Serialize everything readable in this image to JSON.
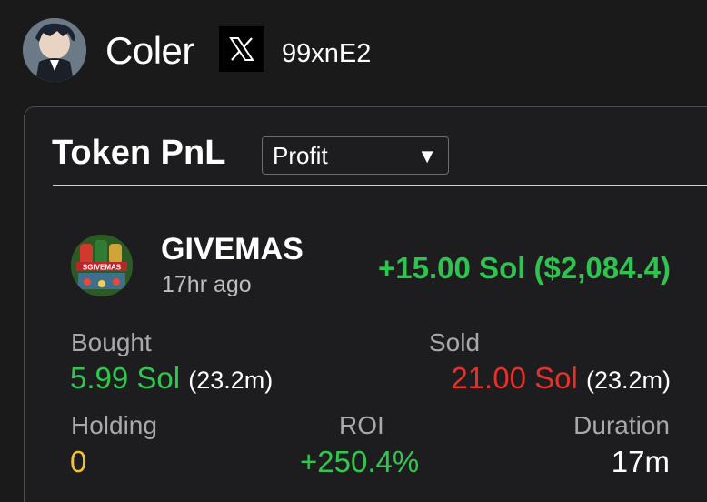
{
  "profile": {
    "name": "Coler",
    "x_icon": "x-logo-icon",
    "handle": "99xnE2"
  },
  "card": {
    "title": "Token PnL",
    "filter_selected": "Profit",
    "filter_caret": "▼",
    "token": {
      "name": "GIVEMAS",
      "logo_text": "SGIVEMAS",
      "time_ago": "17hr ago",
      "pnl": "+15.00 Sol ($2,084.4)"
    },
    "stats": {
      "bought_label": "Bought",
      "bought_value": "5.99 Sol",
      "bought_amount": "(23.2m)",
      "sold_label": "Sold",
      "sold_value": "21.00 Sol",
      "sold_amount": "(23.2m)",
      "holding_label": "Holding",
      "holding_value": "0",
      "roi_label": "ROI",
      "roi_value": "+250.4%",
      "duration_label": "Duration",
      "duration_value": "17m"
    }
  },
  "colors": {
    "profit_green": "#31c74e",
    "loss_red": "#e5322d",
    "holding_yellow": "#f1c232"
  }
}
